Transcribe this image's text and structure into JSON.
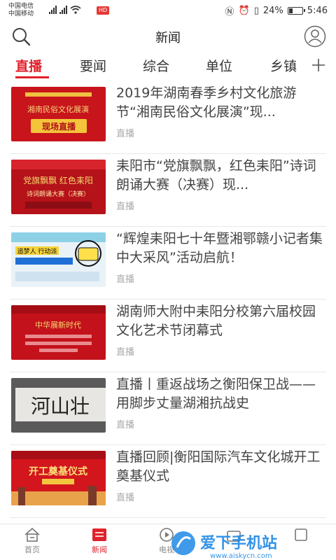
{
  "status_bar": {
    "carrier_1": "中国电信",
    "carrier_2": "中国移动",
    "network_1": "4G",
    "network_2": "4G",
    "hd_badge": "HD",
    "battery": "24%",
    "time": "5:46"
  },
  "header": {
    "title": "新闻",
    "search_icon": "search-icon",
    "user_icon": "user-icon"
  },
  "tabs": [
    {
      "label": "直播",
      "active": true
    },
    {
      "label": "要闻",
      "active": false
    },
    {
      "label": "综合",
      "active": false
    },
    {
      "label": "单位",
      "active": false
    },
    {
      "label": "乡镇",
      "active": false
    }
  ],
  "items": [
    {
      "title": "2019年湖南春季乡村文化旅游节“湘南民俗文化展演”现...",
      "tag": "直播",
      "thumb_text": "现场直播"
    },
    {
      "title": "耒阳市“党旗飘飘，红色耒阳”诗词朗诵大赛（决赛）现...",
      "tag": "直播",
      "thumb_text": "诗词朗诵大赛（决赛）"
    },
    {
      "title": "“辉煌耒阳七十年暨湘鄂赣小记者集中大采风”活动启航！",
      "tag": "直播",
      "thumb_text": "追梦人 行动派"
    },
    {
      "title": "湖南师大附中耒阳分校第六届校园文化艺术节闭幕式",
      "tag": "直播",
      "thumb_text": "中华展新时代"
    },
    {
      "title": "直播丨重返战场之衡阳保卫战——用脚步丈量湖湘抗战史",
      "tag": "直播",
      "thumb_text": "河山壮"
    },
    {
      "title": "直播回顾|衡阳国际汽车文化城开工奠基仪式",
      "tag": "直播",
      "thumb_text": "开工奠基仪式"
    }
  ],
  "bottom_nav": [
    {
      "label": "首页",
      "icon": "home-icon",
      "active": false
    },
    {
      "label": "新闻",
      "icon": "news-icon",
      "active": true
    },
    {
      "label": "电视",
      "icon": "tv-icon",
      "active": false
    },
    {
      "label": "",
      "icon": "radio-icon",
      "active": false
    },
    {
      "label": "",
      "icon": "profile-icon",
      "active": false
    }
  ],
  "watermark": {
    "text": "爱下手机站",
    "url_text": "www.aiskycn.com"
  },
  "colors": {
    "accent": "#e0212b",
    "text": "#444444",
    "muted": "#aaaaaa"
  }
}
